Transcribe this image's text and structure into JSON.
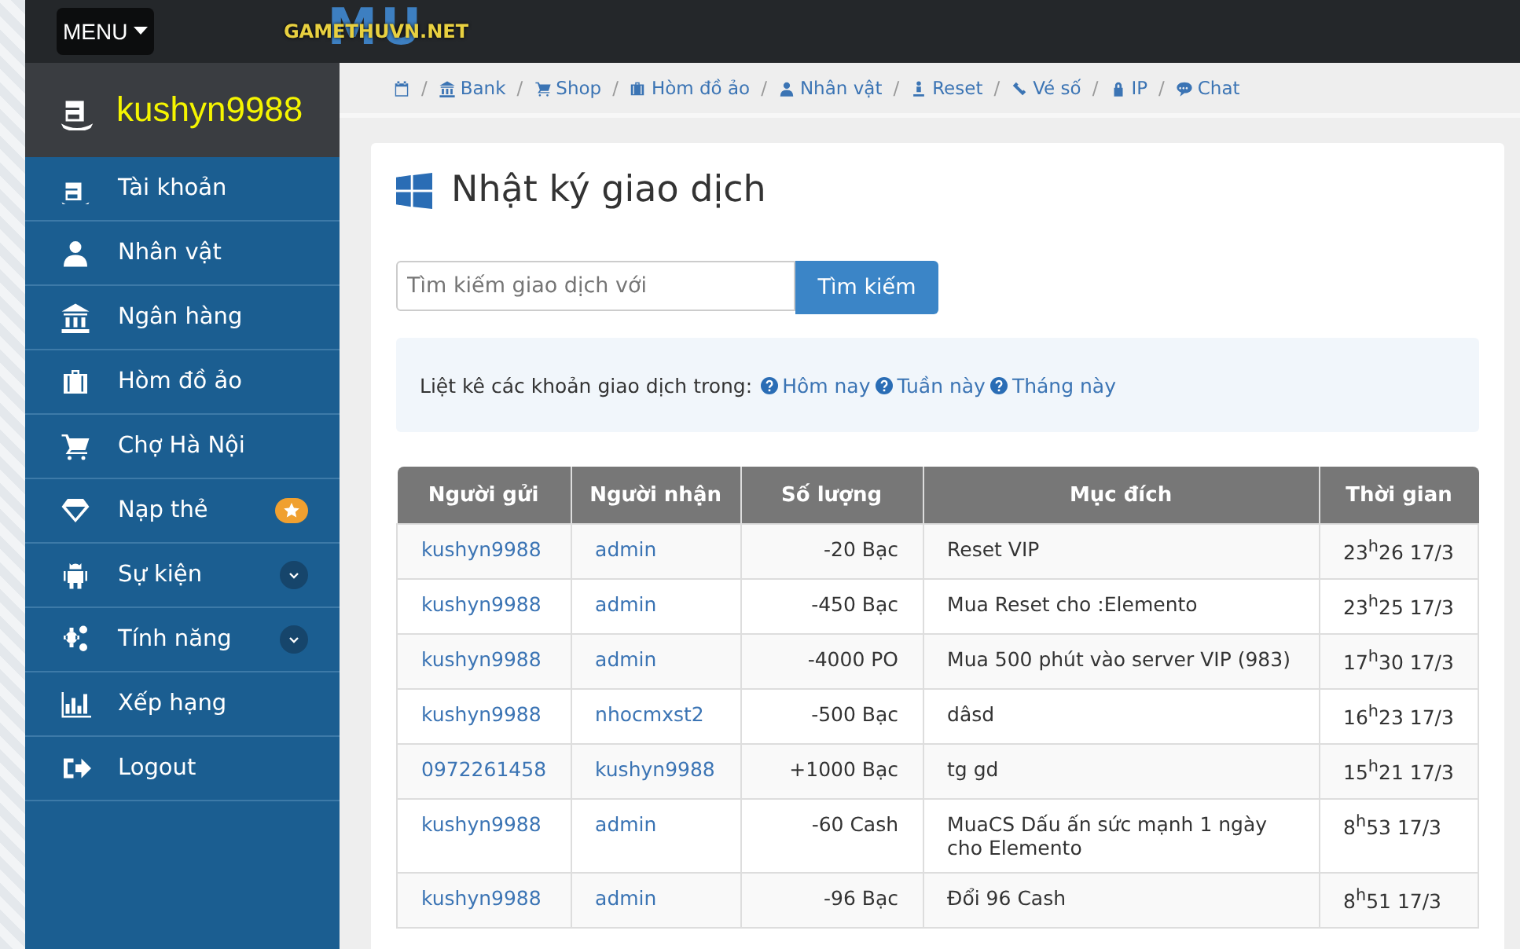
{
  "topbar": {
    "menu_label": "MENU",
    "logo": {
      "text": "GAMETHUVN.NET",
      "backdrop": "MU"
    }
  },
  "sidebar": {
    "username": "kushyn9988",
    "items": [
      {
        "label": "Tài khoản",
        "kind": "link"
      },
      {
        "label": "Nhân vật",
        "kind": "link"
      },
      {
        "label": "Ngân hàng",
        "kind": "link"
      },
      {
        "label": "Hòm đồ ảo",
        "kind": "link"
      },
      {
        "label": "Chợ Hà Nội",
        "kind": "link"
      },
      {
        "label": "Nạp thẻ",
        "kind": "starred"
      },
      {
        "label": "Sự kiện",
        "kind": "dropdown"
      },
      {
        "label": "Tính năng",
        "kind": "dropdown"
      },
      {
        "label": "Xếp hạng",
        "kind": "link"
      },
      {
        "label": "Logout",
        "kind": "link"
      }
    ]
  },
  "breadcrumb": [
    {
      "separator": "/",
      "label": "Bank"
    },
    {
      "separator": "/",
      "label": "Shop"
    },
    {
      "separator": "/",
      "label": "Hòm đồ ảo"
    },
    {
      "separator": "/",
      "label": "Nhân vật"
    },
    {
      "separator": "/",
      "label": "Reset"
    },
    {
      "separator": "/",
      "label": "Vé số"
    },
    {
      "separator": "/",
      "label": "IP"
    },
    {
      "separator": "/",
      "label": "Chat"
    }
  ],
  "page_title": "Nhật ký giao dịch",
  "search": {
    "placeholder": "Tìm kiếm giao dịch với",
    "button": "Tìm kiếm"
  },
  "filter": {
    "text": "Liệt kê các khoản giao dịch trong:",
    "links": [
      "Hôm nay",
      "Tuần này",
      "Tháng này"
    ]
  },
  "table": {
    "columns": [
      "Người gửi",
      "Người nhận",
      "Số lượng",
      "Mục đích",
      "Thời gian"
    ],
    "rows": [
      [
        "kushyn9988",
        "admin",
        "-20  Bạc",
        "Reset VIP",
        "23$^{h}$26 17/3"
      ],
      [
        "kushyn9988",
        "admin",
        "-450  Bạc",
        "Mua Reset cho :Elemento",
        "23$^{h}$25 17/3"
      ],
      [
        "kushyn9988",
        "admin",
        "-4000  PO",
        "Mua 500 phút vào server VIP (983)",
        "17$^{h}$30 17/3"
      ],
      [
        "kushyn9988",
        "nhocmxst2",
        "-500  Bạc",
        "dâsd",
        "16$^{h}$23 17/3"
      ],
      [
        "0972261458",
        "kushyn9988",
        "+1000  Bạc",
        "tg gd",
        "15$^{h}$21 17/3"
      ],
      [
        "kushyn9988",
        "admin",
        "-60  Cash",
        "MuaCS Dấu ấn sức mạnh 1 ngày cho Elemento",
        "8$^{h}$53 17/3"
      ],
      [
        "kushyn9988",
        "admin",
        "-96  Bạc",
        "Đổi 96 Cash",
        "8$^{h}$51 17/3"
      ]
    ]
  }
}
